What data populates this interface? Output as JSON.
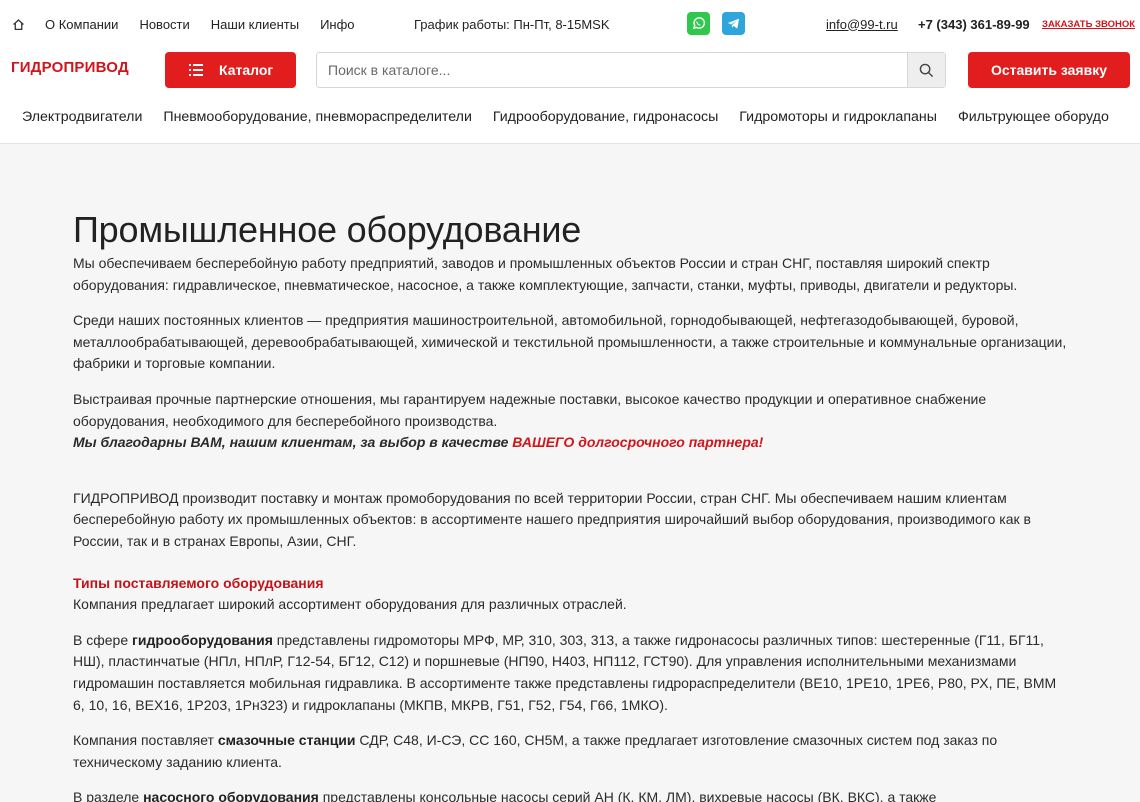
{
  "colors": {
    "accent": "#e11d1d",
    "brand_red": "#d0151b",
    "whatsapp": "#2fc84c",
    "telegram": "#2ea6db"
  },
  "topbar": {
    "home_icon": "home-icon",
    "nav": [
      "О Компании",
      "Новости",
      "Наши клиенты",
      "Инфо"
    ],
    "schedule": "График работы: Пн-Пт, 8-15MSK",
    "whatsapp_icon": "whatsapp-icon",
    "telegram_icon": "telegram-icon",
    "email": "info@99-t.ru",
    "phone": "+7 (343) 361-89-99",
    "callback": "ЗАКАЗАТЬ ЗВОНОК"
  },
  "mainbar": {
    "logo": "ГИДРОПРИВОД",
    "catalog_label": "Каталог",
    "search_placeholder": "Поиск в каталоге...",
    "order_label": "Оставить заявку"
  },
  "catnav": [
    "Электродвигатели",
    "Пневмооборудование, пневмораспределители",
    "Гидрооборудование, гидронасосы",
    "Гидромоторы и гидроклапаны",
    "Фильтрующее оборудо"
  ],
  "content": {
    "title": "Промышленное оборудование",
    "p1": "Мы обеспечиваем бесперебойную работу предприятий, заводов и промышленных объектов России и стран СНГ, поставляя широкий спектр оборудования: гидравлическое, пневматическое, насосное, а также комплектующие, запчасти, станки, муфты, приводы, двигатели и редукторы.",
    "p2": "Среди наших постоянных клиентов — предприятия машиностроительной, автомобильной, горнодобывающей, нефтегазодобывающей, буровой, металлообрабатывающей, деревообрабатывающей, химической и текстильной промышленности, а также строительные и коммунальные организации, фабрики и торговые компании.",
    "p3": "Выстраивая прочные партнерские отношения, мы гарантируем надежные поставки, высокое качество продукции и оперативное снабжение оборудования, необходимого для бесперебойного производства.",
    "thanks_a": "Мы благодарны ВАМ, нашим клиентам, за выбор в качестве ",
    "thanks_b": "ВАШЕГО долгосрочного партнера!",
    "p4": "ГИДРОПРИВОД  производит поставку и монтаж промоборудования по всей территории России, стран СНГ. Мы обеспечиваем нашим клиентам бесперебойную работу их промышленных объектов: в ассортименте нашего предприятия широчайший выбор оборудования, производимого как в России, так и в странах Европы, Азии, СНГ.",
    "types_title": "Типы поставляемого оборудования",
    "types_intro": "Компания предлагает широкий ассортимент оборудования для различных отраслей.",
    "hydro_a": "В сфере ",
    "hydro_b": "гидрооборудования",
    "hydro_c": " представлены гидромоторы МРФ, МР, 310, 303, 313, а также гидронасосы различных типов: шестеренные (Г11, БГ11, НШ), пластинчатые (НПл, НПлР, Г12-54, БГ12, С12) и поршневые (НП90, Н403, НП112, ГСТ90). Для управления исполнительными механизмами гидромашин поставляется мобильная гидравлика. В ассортименте также представлены гидрораспределители (ВЕ10, 1РЕ10, 1РЕ6, Р80, РХ, ПЕ, ВММ 6, 10, 16, ВЕХ16, 1Р203, 1Рн323) и гидроклапаны (МКПВ, МКРВ, Г51, Г52, Г54, Г66, 1МКО).",
    "lube_a": "Компания поставляет ",
    "lube_b": "смазочные станции",
    "lube_c": " СДР, С48, И-СЭ, СС 160, СН5М, а также предлагает изготовление смазочных систем под заказ по техническому заданию клиента.",
    "pump_a": "В разделе ",
    "pump_b": "насосного оборудования",
    "pump_c": " представлены консольные насосы серий АН (К, КМ, ЛМ), вихревые насосы (ВК, ВКС), а также"
  }
}
